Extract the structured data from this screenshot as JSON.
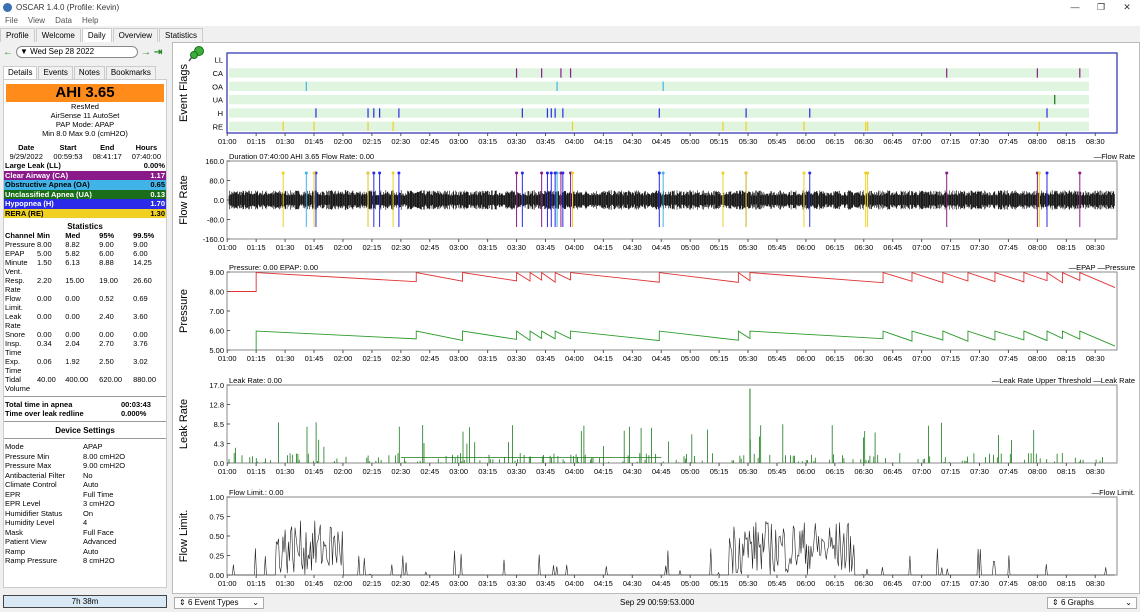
{
  "window": {
    "title": "OSCAR 1.4.0 (Profile: Kevin)"
  },
  "menu": [
    "File",
    "View",
    "Data",
    "Help"
  ],
  "main_tabs": [
    {
      "label": "Profile"
    },
    {
      "label": "Welcome"
    },
    {
      "label": "Daily",
      "active": true
    },
    {
      "label": "Overview"
    },
    {
      "label": "Statistics"
    }
  ],
  "date_nav": {
    "date": "Wed Sep 28 2022"
  },
  "detail_tabs": [
    {
      "label": "Details",
      "active": true
    },
    {
      "label": "Events"
    },
    {
      "label": "Notes"
    },
    {
      "label": "Bookmarks"
    }
  ],
  "summary": {
    "ahi": "AHI 3.65",
    "lines": [
      "ResMed",
      "AirSense 11 AutoSet",
      "PAP Mode: APAP",
      "Min 8.0 Max 9.0 (cmH2O)"
    ]
  },
  "session": {
    "headers": [
      "Date",
      "Start",
      "End",
      "Hours"
    ],
    "row": [
      "9/29/2022",
      "00:59:53",
      "08:41:17",
      "07:40:00"
    ]
  },
  "events": [
    {
      "label": "Large Leak (LL)",
      "value": "0.00%",
      "bg": "#ffffff",
      "fg": "#000000"
    },
    {
      "label": "Clear Airway (CA)",
      "value": "1.17",
      "bg": "#8a1a8a",
      "fg": "#ffffff"
    },
    {
      "label": "Obstructive Apnea (OA)",
      "value": "0.65",
      "bg": "#40b4e8",
      "fg": "#000000"
    },
    {
      "label": "Unclassified Apnea (UA)",
      "value": "0.13",
      "bg": "#1a6e1a",
      "fg": "#ffffff"
    },
    {
      "label": "Hypopnea (H)",
      "value": "1.70",
      "bg": "#2a2ae8",
      "fg": "#ffffff"
    },
    {
      "label": "RERA (RE)",
      "value": "1.30",
      "bg": "#f0d020",
      "fg": "#000000"
    }
  ],
  "statistics": {
    "title": "Statistics",
    "headers": [
      "Channel",
      "Min",
      "Med",
      "95%",
      "99.5%"
    ],
    "rows": [
      [
        "Pressure",
        "8.00",
        "8.82",
        "9.00",
        "9.00"
      ],
      [
        "EPAP",
        "5.00",
        "5.82",
        "6.00",
        "6.00"
      ],
      [
        "Minute Vent.",
        "1.50",
        "6.13",
        "8.88",
        "14.25"
      ],
      [
        "Resp. Rate",
        "2.20",
        "15.00",
        "19.00",
        "26.60"
      ],
      [
        "Flow Limit.",
        "0.00",
        "0.00",
        "0.52",
        "0.69"
      ],
      [
        "Leak Rate",
        "0.00",
        "0.00",
        "2.40",
        "3.60"
      ],
      [
        "Snore",
        "0.00",
        "0.00",
        "0.00",
        "0.00"
      ],
      [
        "Insp. Time",
        "0.34",
        "2.04",
        "2.70",
        "3.76"
      ],
      [
        "Exp. Time",
        "0.06",
        "1.92",
        "2.50",
        "3.02"
      ],
      [
        "Tidal Volume",
        "40.00",
        "400.00",
        "620.00",
        "880.00"
      ]
    ]
  },
  "totals": [
    {
      "label": "Total time in apnea",
      "value": "00:03:43"
    },
    {
      "label": "Time over leak redline",
      "value": "0.000%"
    }
  ],
  "device": {
    "title": "Device Settings",
    "rows": [
      [
        "Mode",
        "APAP"
      ],
      [
        "Pressure Min",
        "8.00 cmH2O"
      ],
      [
        "Pressure Max",
        "9.00 cmH2O"
      ],
      [
        "Antibacterial Filter",
        "No"
      ],
      [
        "Climate Control",
        "Auto"
      ],
      [
        "EPR",
        "Full Time"
      ],
      [
        "EPR Level",
        "3 cmH2O"
      ],
      [
        "Humidifier Status",
        "On"
      ],
      [
        "Humidity Level",
        "4"
      ],
      [
        "Mask",
        "Full Face"
      ],
      [
        "Patient View",
        "Advanced"
      ],
      [
        "Ramp",
        "Auto"
      ],
      [
        "Ramp Pressure",
        "8 cmH2O"
      ]
    ]
  },
  "bottom": {
    "duration": "7h 38m",
    "event_types": "6 Event Types",
    "timestamp": "Sep 29 00:59:53.000",
    "graphs": "6 Graphs"
  },
  "x_ticks": [
    "01:00",
    "01:15",
    "01:30",
    "01:45",
    "02:00",
    "02:15",
    "02:30",
    "02:45",
    "03:00",
    "03:15",
    "03:30",
    "03:45",
    "04:00",
    "04:15",
    "04:30",
    "04:45",
    "05:00",
    "05:15",
    "05:30",
    "05:45",
    "06:00",
    "06:15",
    "06:30",
    "06:45",
    "07:00",
    "07:15",
    "07:30",
    "07:45",
    "08:00",
    "08:15",
    "08:30"
  ],
  "chart_data": [
    {
      "type": "timeline",
      "ylabel": "Event Flags",
      "rows": [
        "LL",
        "CA",
        "OA",
        "UA",
        "H",
        "RE"
      ],
      "colors": {
        "CA": "#8a1a8a",
        "OA": "#40b4e8",
        "UA": "#1a6e1a",
        "H": "#2a2ae8",
        "RE": "#f0d020"
      },
      "events": {
        "LL": [],
        "CA": [
          "03:30",
          "03:43",
          "03:53",
          "03:58",
          "07:13",
          "08:00",
          "08:22"
        ],
        "OA": [
          "01:41",
          "03:51",
          "04:46"
        ],
        "UA": [
          "08:09"
        ],
        "H": [
          "01:46",
          "02:13",
          "02:16",
          "02:19",
          "02:29",
          "03:33",
          "03:46",
          "03:48",
          "03:50",
          "03:54",
          "04:44",
          "05:29",
          "06:02",
          "08:05"
        ],
        "RE": [
          "01:29",
          "01:45",
          "02:13",
          "02:26",
          "03:59",
          "05:17",
          "05:29",
          "05:59",
          "06:31",
          "06:32",
          "08:01"
        ]
      }
    },
    {
      "type": "line",
      "ylabel": "Flow Rate",
      "header": "Duration 07:40:00 AHI 3.65 Flow Rate: 0.00",
      "legend": [
        "Flow Rate"
      ],
      "yticks": [
        "160.0",
        "80.0",
        "0.0",
        "-80.0",
        "-160.0"
      ],
      "ylim": [
        -160,
        160
      ]
    },
    {
      "type": "line",
      "ylabel": "Pressure",
      "header": "Pressure: 0.00 EPAP: 0.00",
      "legend": [
        "EPAP",
        "Pressure"
      ],
      "yticks": [
        "9.00",
        "8.00",
        "7.00",
        "6.00",
        "5.00"
      ],
      "ylim": [
        5,
        9
      ],
      "series": [
        {
          "name": "Pressure",
          "color": "#e03030"
        },
        {
          "name": "EPAP",
          "color": "#2a9a2a"
        }
      ]
    },
    {
      "type": "line",
      "ylabel": "Leak Rate",
      "header": "Leak Rate: 0.00",
      "legend": [
        "Leak Rate Upper Threshold",
        "Leak Rate"
      ],
      "yticks": [
        "17.0",
        "12.8",
        "8.5",
        "4.3",
        "0.0"
      ],
      "ylim": [
        0,
        17
      ]
    },
    {
      "type": "line",
      "ylabel": "Flow Limit.",
      "header": "Flow Limit.: 0.00",
      "legend": [
        "Flow Limit."
      ],
      "yticks": [
        "1.00",
        "0.75",
        "0.50",
        "0.25",
        "0.00"
      ],
      "ylim": [
        0,
        1
      ]
    }
  ]
}
